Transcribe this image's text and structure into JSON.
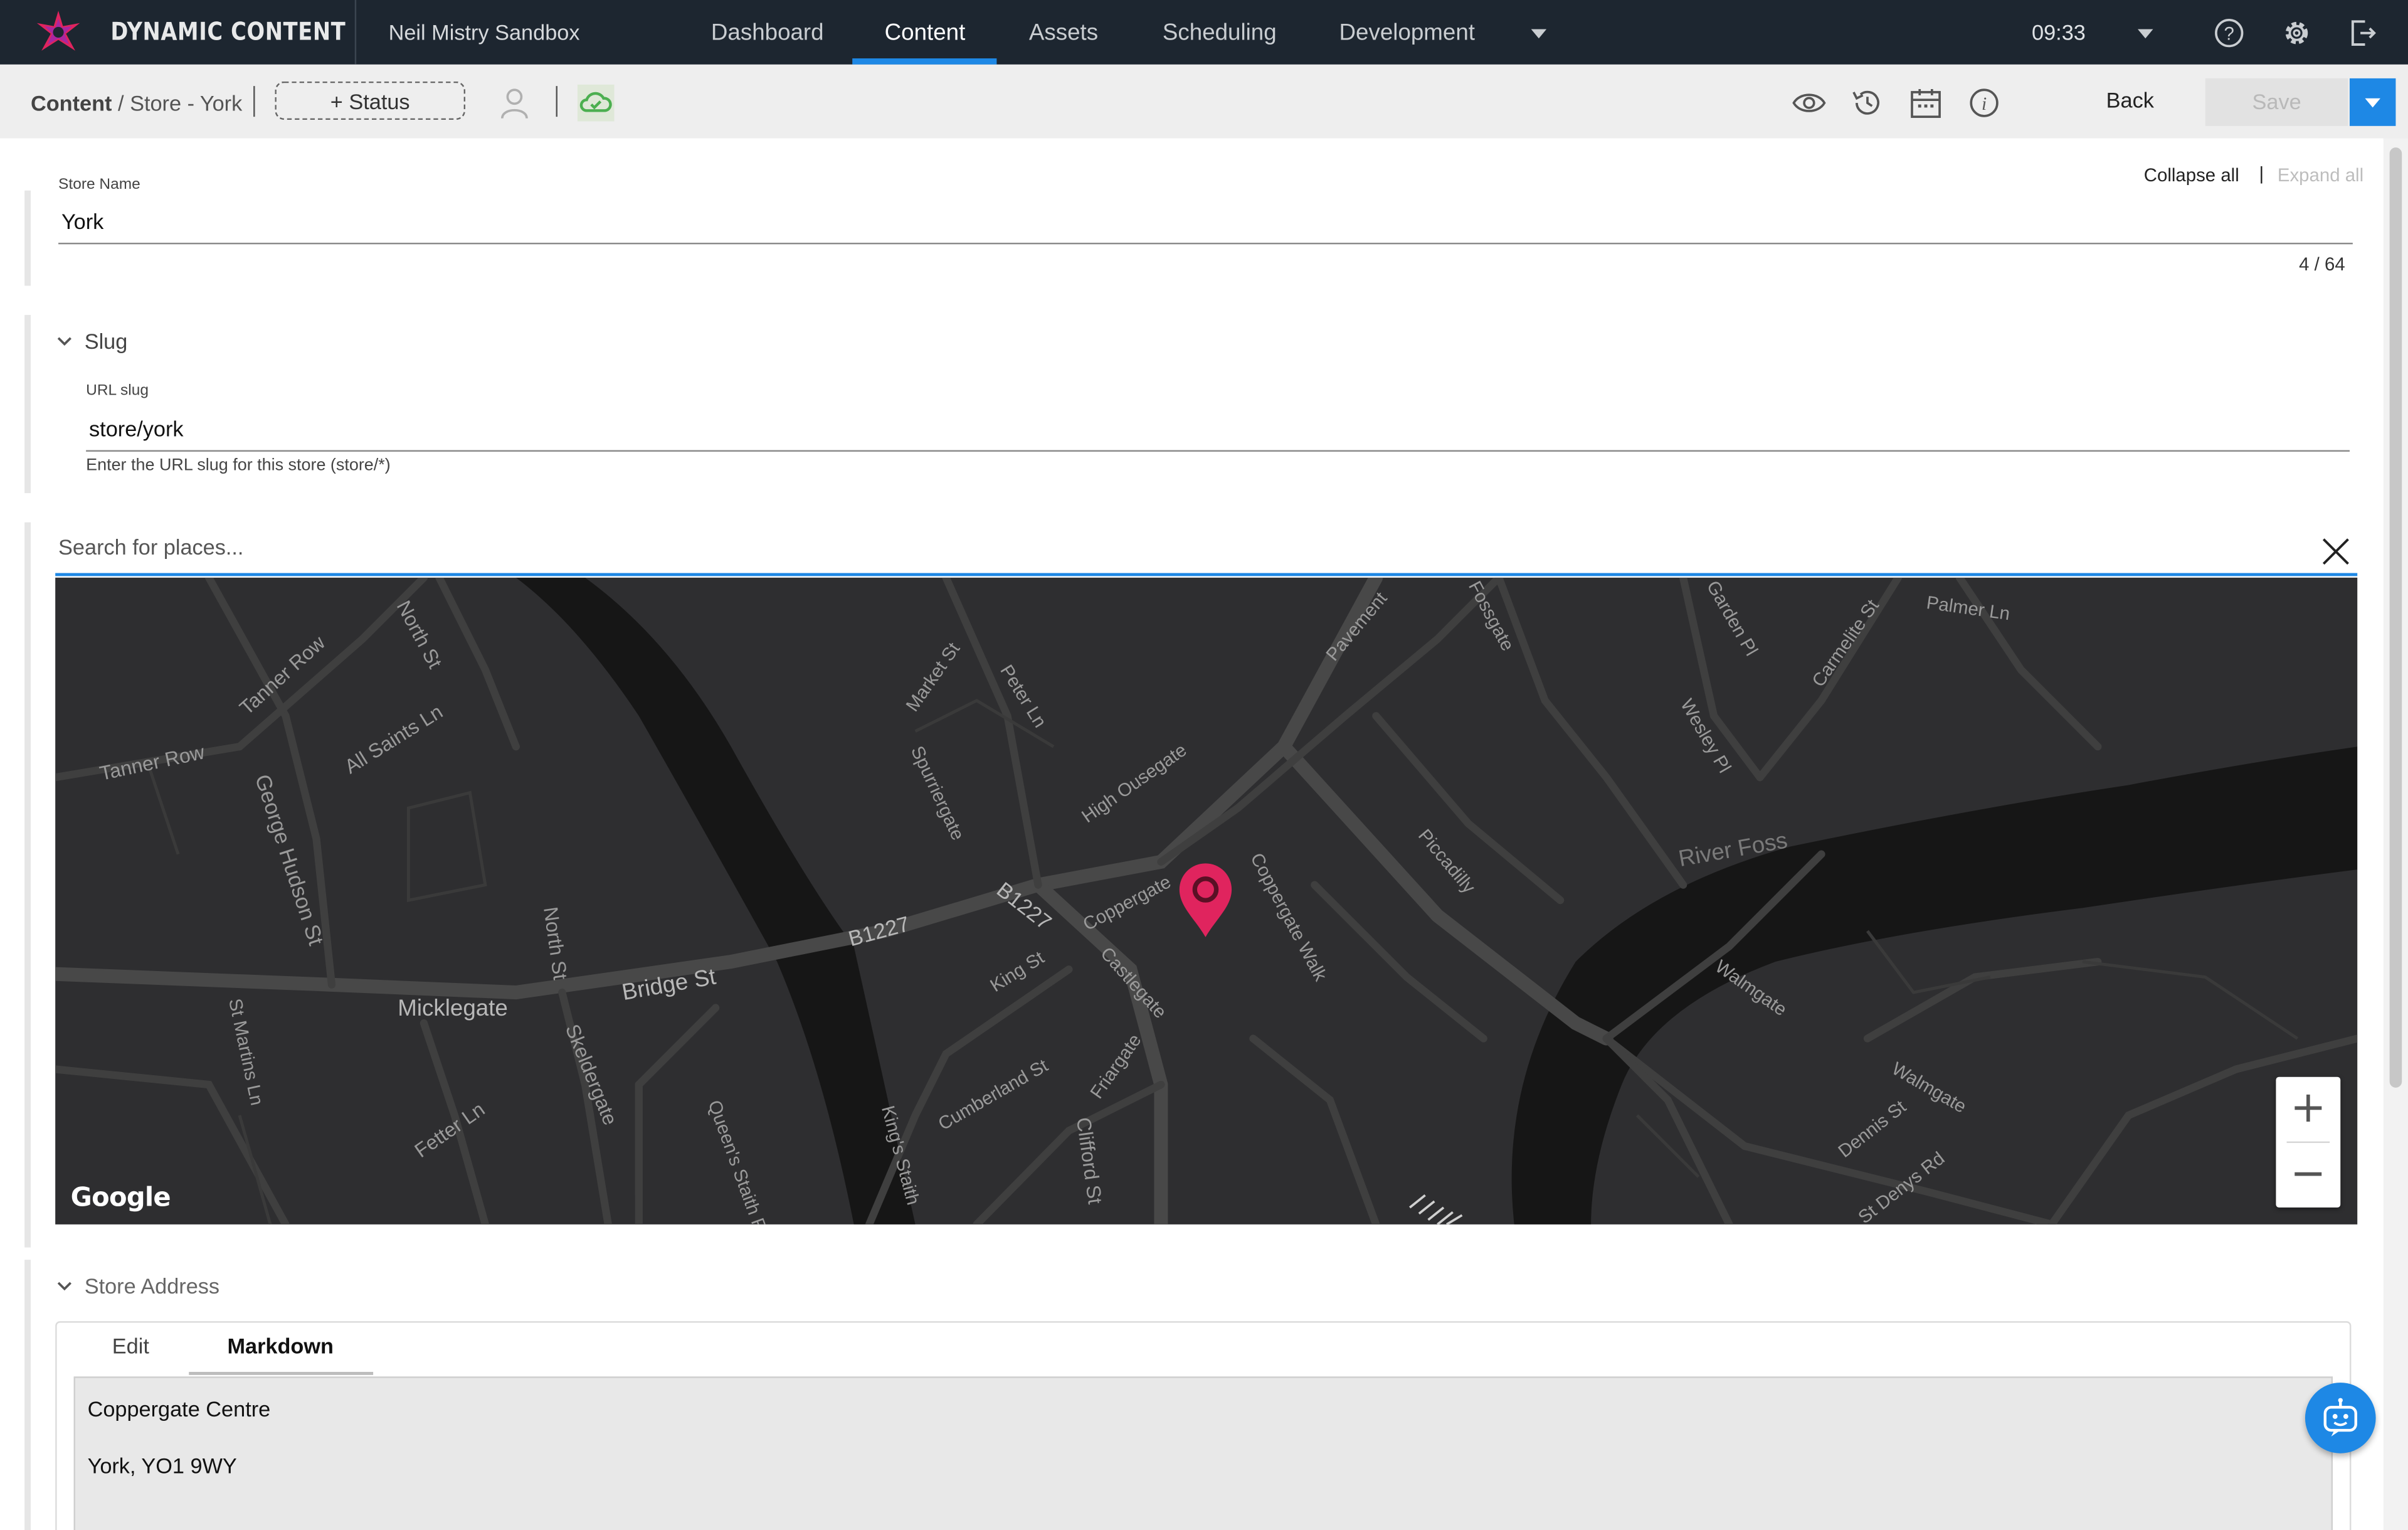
{
  "app": {
    "brand": "DYNAMIC CONTENT",
    "workspace": "Neil Mistry Sandbox",
    "nav_tabs": [
      {
        "label": "Dashboard"
      },
      {
        "label": "Content"
      },
      {
        "label": "Assets"
      },
      {
        "label": "Scheduling"
      },
      {
        "label": "Development"
      }
    ],
    "active_tab": "Content",
    "time": "09:33",
    "accent_color": "#1e88e5",
    "nav_bg_color": "#1d2630",
    "icons": [
      "chevron-down-icon",
      "help-icon",
      "gear-icon",
      "logout-icon"
    ]
  },
  "toolbar": {
    "breadcrumb_root": "Content",
    "breadcrumb_sub": "/ Store - York",
    "status_label": "+ Status",
    "back_label": "Back",
    "save_label": "Save",
    "icons": [
      "user-icon",
      "cloud-sync-icon",
      "eye-icon",
      "history-icon",
      "calendar-icon",
      "info-icon",
      "chevron-down-icon"
    ]
  },
  "form": {
    "collapse_all": "Collapse all",
    "separator": "|",
    "expand_all": "Expand all",
    "store_name": {
      "label": "Store Name",
      "value": "York",
      "counter": "4 / 64"
    },
    "slug": {
      "section_title": "Slug",
      "label": "URL slug",
      "value": "store/york",
      "helper": "Enter the URL slug for this store (store/*)"
    },
    "location": {
      "search_placeholder": "Search for places...",
      "map_attribution": "Google",
      "marker_color": "#e0245e",
      "zoom_in": "+",
      "zoom_out": "−",
      "street_labels": [
        "Tanner Row",
        "Tanner Row",
        "All Saints Ln",
        "North St",
        "George Hudson St",
        "North St",
        "Micklegate",
        "Bridge St",
        "B1227",
        "B1227",
        "Skeldergate",
        "Fetter Ln",
        "Queen's Staith Rd",
        "St Martins Ln",
        "Market St",
        "Peter Ln",
        "Spurriergate",
        "High Ousegate",
        "Coppergate",
        "Coppergate Walk",
        "King St",
        "Castlegate",
        "Friargate",
        "Cumberland St",
        "King's Staith",
        "Clifford St",
        "Pavement",
        "Fossgate",
        "Piccadilly",
        "Garden Pl",
        "Wesley Pl",
        "Carmelite St",
        "Palmer Ln",
        "River Foss",
        "Walmgate",
        "Walmgate",
        "Dennis St",
        "St Denys Rd"
      ]
    },
    "address": {
      "section_title": "Store Address",
      "tab_edit": "Edit",
      "tab_markdown": "Markdown",
      "line1": "Coppergate Centre",
      "line2": "York, YO1 9WY"
    }
  }
}
